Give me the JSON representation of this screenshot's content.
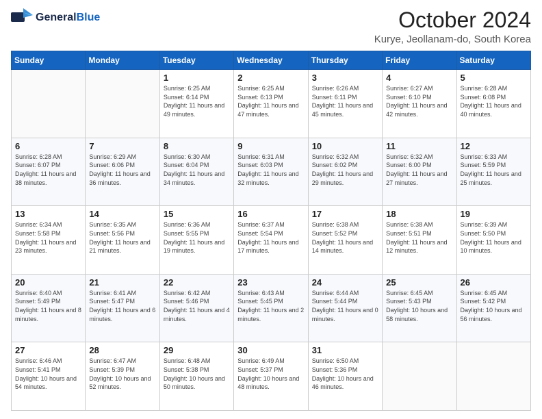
{
  "header": {
    "logo_general": "General",
    "logo_blue": "Blue",
    "month_title": "October 2024",
    "location": "Kurye, Jeollanam-do, South Korea"
  },
  "days_of_week": [
    "Sunday",
    "Monday",
    "Tuesday",
    "Wednesday",
    "Thursday",
    "Friday",
    "Saturday"
  ],
  "weeks": [
    [
      {
        "day": "",
        "info": ""
      },
      {
        "day": "",
        "info": ""
      },
      {
        "day": "1",
        "info": "Sunrise: 6:25 AM\nSunset: 6:14 PM\nDaylight: 11 hours and 49 minutes."
      },
      {
        "day": "2",
        "info": "Sunrise: 6:25 AM\nSunset: 6:13 PM\nDaylight: 11 hours and 47 minutes."
      },
      {
        "day": "3",
        "info": "Sunrise: 6:26 AM\nSunset: 6:11 PM\nDaylight: 11 hours and 45 minutes."
      },
      {
        "day": "4",
        "info": "Sunrise: 6:27 AM\nSunset: 6:10 PM\nDaylight: 11 hours and 42 minutes."
      },
      {
        "day": "5",
        "info": "Sunrise: 6:28 AM\nSunset: 6:08 PM\nDaylight: 11 hours and 40 minutes."
      }
    ],
    [
      {
        "day": "6",
        "info": "Sunrise: 6:28 AM\nSunset: 6:07 PM\nDaylight: 11 hours and 38 minutes."
      },
      {
        "day": "7",
        "info": "Sunrise: 6:29 AM\nSunset: 6:06 PM\nDaylight: 11 hours and 36 minutes."
      },
      {
        "day": "8",
        "info": "Sunrise: 6:30 AM\nSunset: 6:04 PM\nDaylight: 11 hours and 34 minutes."
      },
      {
        "day": "9",
        "info": "Sunrise: 6:31 AM\nSunset: 6:03 PM\nDaylight: 11 hours and 32 minutes."
      },
      {
        "day": "10",
        "info": "Sunrise: 6:32 AM\nSunset: 6:02 PM\nDaylight: 11 hours and 29 minutes."
      },
      {
        "day": "11",
        "info": "Sunrise: 6:32 AM\nSunset: 6:00 PM\nDaylight: 11 hours and 27 minutes."
      },
      {
        "day": "12",
        "info": "Sunrise: 6:33 AM\nSunset: 5:59 PM\nDaylight: 11 hours and 25 minutes."
      }
    ],
    [
      {
        "day": "13",
        "info": "Sunrise: 6:34 AM\nSunset: 5:58 PM\nDaylight: 11 hours and 23 minutes."
      },
      {
        "day": "14",
        "info": "Sunrise: 6:35 AM\nSunset: 5:56 PM\nDaylight: 11 hours and 21 minutes."
      },
      {
        "day": "15",
        "info": "Sunrise: 6:36 AM\nSunset: 5:55 PM\nDaylight: 11 hours and 19 minutes."
      },
      {
        "day": "16",
        "info": "Sunrise: 6:37 AM\nSunset: 5:54 PM\nDaylight: 11 hours and 17 minutes."
      },
      {
        "day": "17",
        "info": "Sunrise: 6:38 AM\nSunset: 5:52 PM\nDaylight: 11 hours and 14 minutes."
      },
      {
        "day": "18",
        "info": "Sunrise: 6:38 AM\nSunset: 5:51 PM\nDaylight: 11 hours and 12 minutes."
      },
      {
        "day": "19",
        "info": "Sunrise: 6:39 AM\nSunset: 5:50 PM\nDaylight: 11 hours and 10 minutes."
      }
    ],
    [
      {
        "day": "20",
        "info": "Sunrise: 6:40 AM\nSunset: 5:49 PM\nDaylight: 11 hours and 8 minutes."
      },
      {
        "day": "21",
        "info": "Sunrise: 6:41 AM\nSunset: 5:47 PM\nDaylight: 11 hours and 6 minutes."
      },
      {
        "day": "22",
        "info": "Sunrise: 6:42 AM\nSunset: 5:46 PM\nDaylight: 11 hours and 4 minutes."
      },
      {
        "day": "23",
        "info": "Sunrise: 6:43 AM\nSunset: 5:45 PM\nDaylight: 11 hours and 2 minutes."
      },
      {
        "day": "24",
        "info": "Sunrise: 6:44 AM\nSunset: 5:44 PM\nDaylight: 11 hours and 0 minutes."
      },
      {
        "day": "25",
        "info": "Sunrise: 6:45 AM\nSunset: 5:43 PM\nDaylight: 10 hours and 58 minutes."
      },
      {
        "day": "26",
        "info": "Sunrise: 6:45 AM\nSunset: 5:42 PM\nDaylight: 10 hours and 56 minutes."
      }
    ],
    [
      {
        "day": "27",
        "info": "Sunrise: 6:46 AM\nSunset: 5:41 PM\nDaylight: 10 hours and 54 minutes."
      },
      {
        "day": "28",
        "info": "Sunrise: 6:47 AM\nSunset: 5:39 PM\nDaylight: 10 hours and 52 minutes."
      },
      {
        "day": "29",
        "info": "Sunrise: 6:48 AM\nSunset: 5:38 PM\nDaylight: 10 hours and 50 minutes."
      },
      {
        "day": "30",
        "info": "Sunrise: 6:49 AM\nSunset: 5:37 PM\nDaylight: 10 hours and 48 minutes."
      },
      {
        "day": "31",
        "info": "Sunrise: 6:50 AM\nSunset: 5:36 PM\nDaylight: 10 hours and 46 minutes."
      },
      {
        "day": "",
        "info": ""
      },
      {
        "day": "",
        "info": ""
      }
    ]
  ]
}
